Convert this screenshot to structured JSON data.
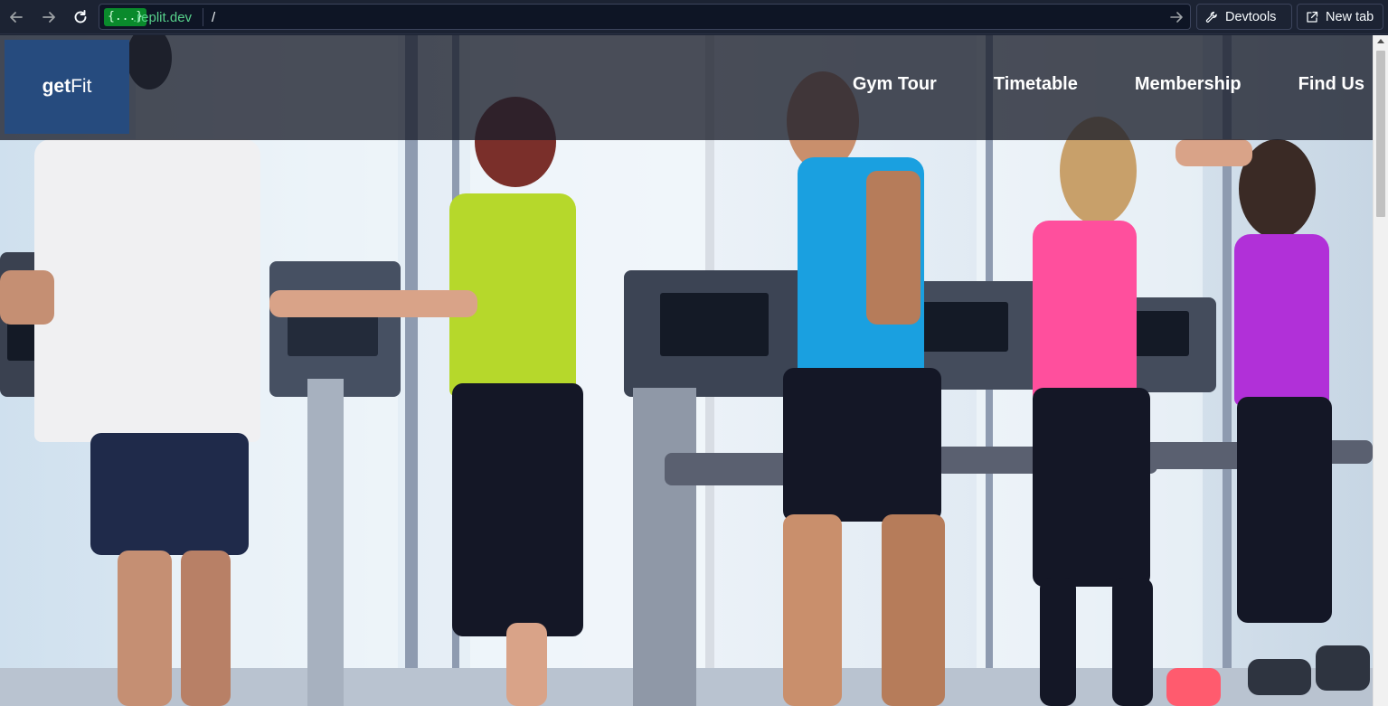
{
  "browser": {
    "url_badge": "{...}",
    "url_domain": ".replit.dev",
    "url_path": "/",
    "devtools_label": "Devtools",
    "newtab_label": "New tab"
  },
  "site": {
    "logo_bold": "get",
    "logo_light": "Fit",
    "nav": [
      "Gym Tour",
      "Timetable",
      "Membership",
      "Find Us"
    ]
  },
  "colors": {
    "header_overlay": "#1a1e2a",
    "logo_bg": "#264b7e",
    "url_domain": "#57d18b",
    "url_badge_bg": "#0a8a2c"
  }
}
